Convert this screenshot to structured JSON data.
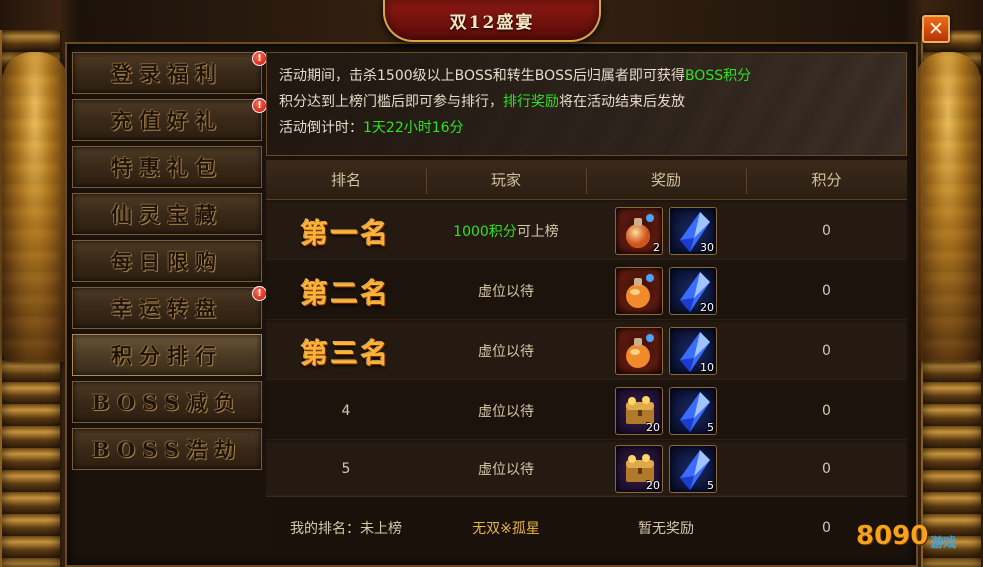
{
  "window": {
    "title": "双12盛宴",
    "close_icon": "close-icon"
  },
  "menu": {
    "items": [
      {
        "label": "登录福利",
        "badge": "!"
      },
      {
        "label": "充值好礼",
        "badge": "!"
      },
      {
        "label": "特惠礼包",
        "badge": ""
      },
      {
        "label": "仙灵宝藏",
        "badge": ""
      },
      {
        "label": "每日限购",
        "badge": ""
      },
      {
        "label": "幸运转盘",
        "badge": "!"
      },
      {
        "label": "积分排行",
        "badge": "",
        "active": true
      },
      {
        "label": "BOSS减负",
        "badge": ""
      },
      {
        "label": "BOSS浩劫",
        "badge": ""
      }
    ]
  },
  "info": {
    "line1_pre": "活动期间，击杀1500级以上BOSS和转生BOSS后归属者即可获得",
    "line1_hl": "BOSS积分",
    "line2_pre": "积分达到上榜门槛后即可参与排行，",
    "line2_hl": "排行奖励",
    "line2_post": "将在活动结束后发放",
    "line3_pre": "活动倒计时：",
    "line3_hl": "1天22小时16分"
  },
  "table": {
    "headers": {
      "rank": "排名",
      "player": "玩家",
      "reward": "奖励",
      "score": "积分"
    },
    "rows": [
      {
        "rank": "第一名",
        "player_hl": "1000积分",
        "player_post": "可上榜",
        "reward1": "2",
        "reward2": "30",
        "score": "0"
      },
      {
        "rank": "第二名",
        "player_hl": "",
        "player_post": "虚位以待",
        "reward1": "",
        "reward2": "20",
        "score": "0"
      },
      {
        "rank": "第三名",
        "player_hl": "",
        "player_post": "虚位以待",
        "reward1": "",
        "reward2": "10",
        "score": "0"
      },
      {
        "rank": "4",
        "player_hl": "",
        "player_post": "虚位以待",
        "reward1": "20",
        "reward2": "5",
        "score": "0"
      },
      {
        "rank": "5",
        "player_hl": "",
        "player_post": "虚位以待",
        "reward1": "20",
        "reward2": "5",
        "score": "0"
      }
    ],
    "footer": {
      "my_rank": "我的排名：未上榜",
      "player_name": "无双※孤星",
      "reward": "暂无奖励",
      "score": "0"
    }
  },
  "watermark": {
    "number": "8090",
    "text": "游戏"
  },
  "colors": {
    "highlight": "#2ee31f",
    "rank_gold": "#ffb236",
    "name_gold": "#e7b547",
    "badge_red": "#c0140a"
  }
}
